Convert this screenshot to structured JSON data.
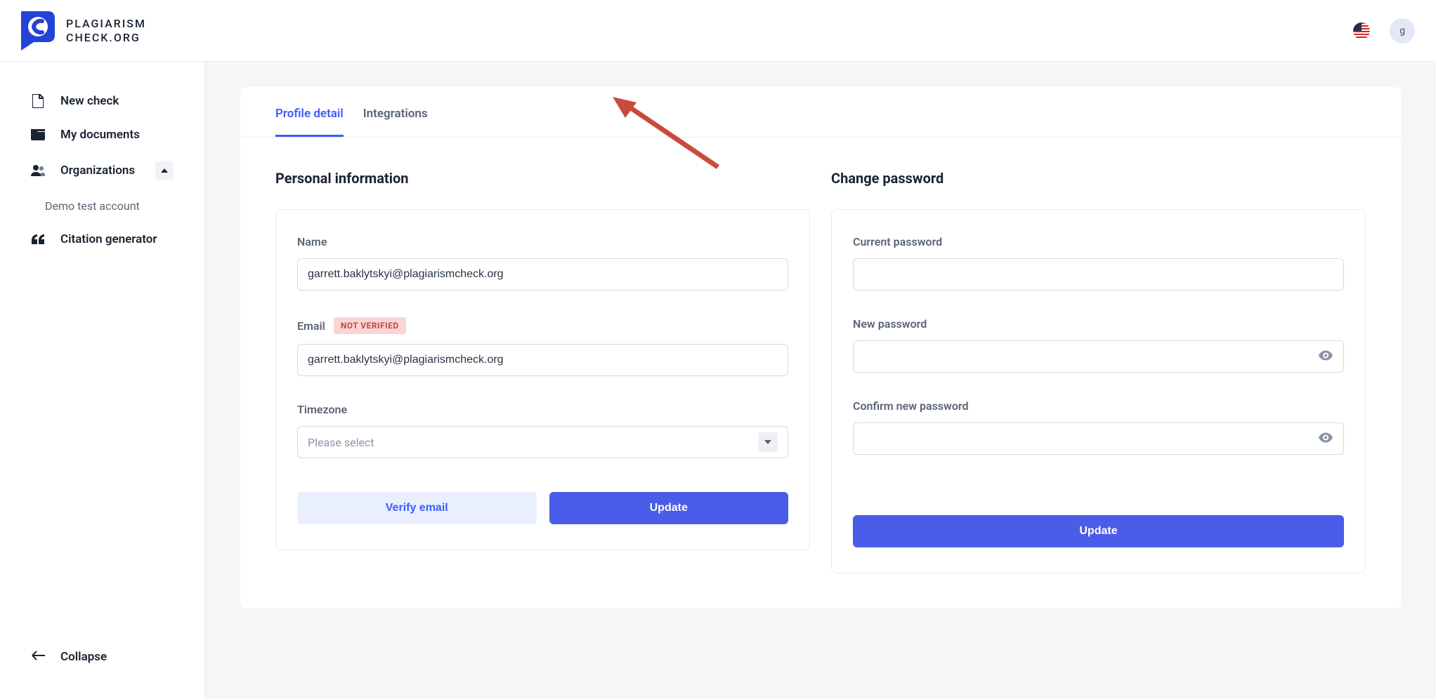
{
  "header": {
    "logo_line1": "PLAGIARISM",
    "logo_line2": "CHECK.ORG",
    "avatar_initial": "g"
  },
  "sidebar": {
    "items": [
      {
        "label": "New check"
      },
      {
        "label": "My documents"
      },
      {
        "label": "Organizations"
      },
      {
        "label": "Citation generator"
      }
    ],
    "sub_item": "Demo test account",
    "collapse_label": "Collapse"
  },
  "tabs": {
    "profile": "Profile detail",
    "integrations": "Integrations"
  },
  "personal": {
    "title": "Personal information",
    "name_label": "Name",
    "name_value": "garrett.baklytskyi@plagiarismcheck.org",
    "email_label": "Email",
    "email_badge": "NOT VERIFIED",
    "email_value": "garrett.baklytskyi@plagiarismcheck.org",
    "timezone_label": "Timezone",
    "timezone_placeholder": "Please select",
    "verify_btn": "Verify email",
    "update_btn": "Update"
  },
  "password": {
    "title": "Change password",
    "current_label": "Current password",
    "new_label": "New password",
    "confirm_label": "Confirm new password",
    "update_btn": "Update"
  }
}
